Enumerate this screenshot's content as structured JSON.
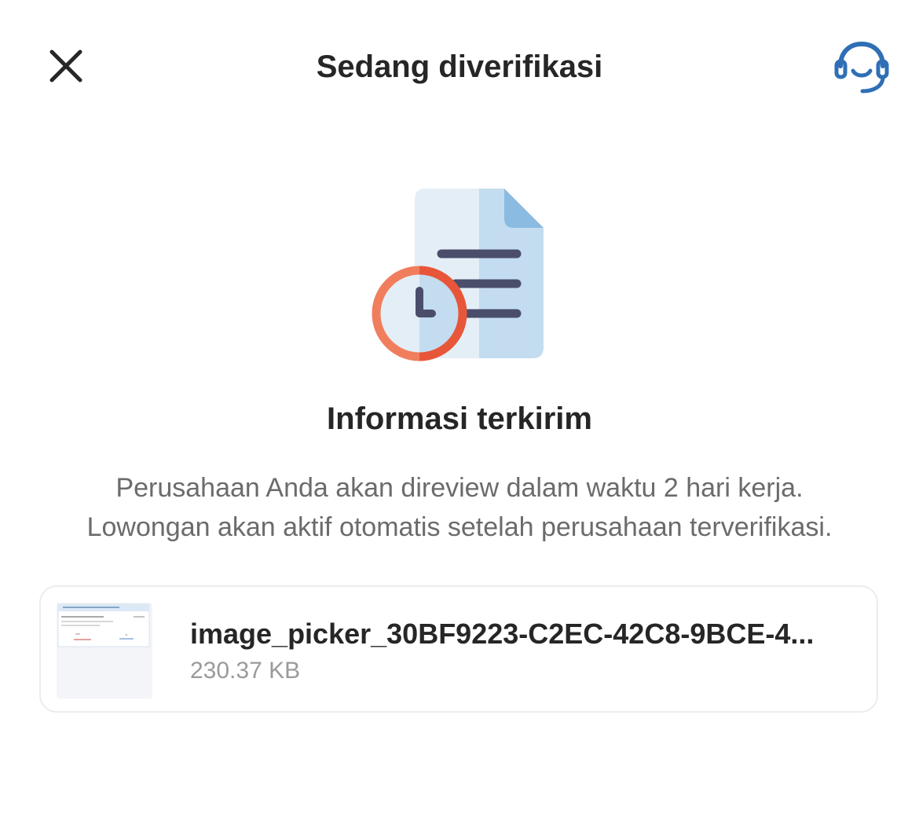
{
  "header": {
    "title": "Sedang diverifikasi",
    "close_icon": "close-icon",
    "support_icon": "headset-support-icon",
    "accent_color": "#2f6fb6"
  },
  "status": {
    "illustration": "document-clock-icon",
    "title": "Informasi terkirim",
    "description_line1": "Perusahaan Anda akan direview dalam waktu 2 hari kerja.",
    "description_line2": "Lowongan akan aktif otomatis setelah perusahaan terverifikasi."
  },
  "file": {
    "name": "image_picker_30BF9223-C2EC-42C8-9BCE-4...",
    "size": "230.37 KB",
    "thumbnail": "image-thumbnail"
  }
}
